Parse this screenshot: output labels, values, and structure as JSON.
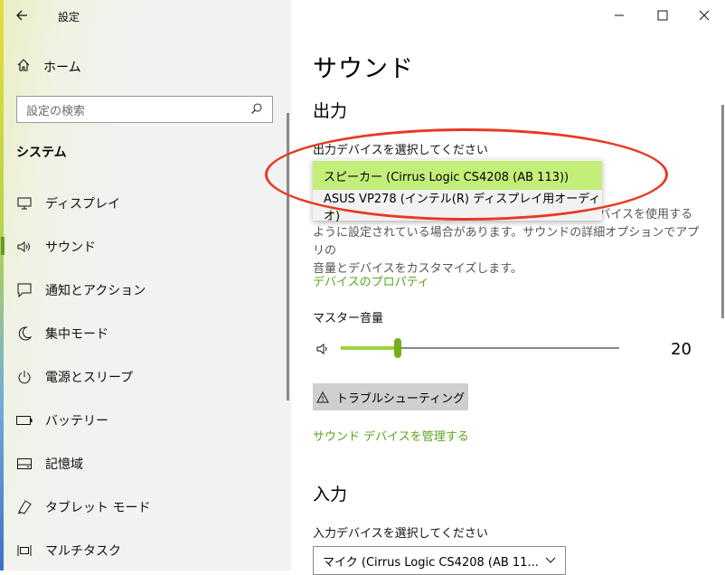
{
  "window": {
    "title": "設定",
    "controls": [
      "minimize",
      "maximize",
      "close"
    ]
  },
  "sidebar": {
    "home_label": "ホーム",
    "search_placeholder": "設定の検索",
    "section_title": "システム",
    "items": [
      {
        "label": "ディスプレイ",
        "icon": "display-icon"
      },
      {
        "label": "サウンド",
        "icon": "speaker-icon",
        "selected": true
      },
      {
        "label": "通知とアクション",
        "icon": "notification-icon"
      },
      {
        "label": "集中モード",
        "icon": "moon-icon"
      },
      {
        "label": "電源とスリープ",
        "icon": "power-icon"
      },
      {
        "label": "バッテリー",
        "icon": "battery-icon"
      },
      {
        "label": "記憶域",
        "icon": "storage-icon"
      },
      {
        "label": "タブレット モード",
        "icon": "tablet-icon"
      },
      {
        "label": "マルチタスク",
        "icon": "multitask-icon"
      }
    ]
  },
  "main": {
    "page_title": "サウンド",
    "output_heading": "出力",
    "output_device_label": "出力デバイスを選択してください",
    "output_options": [
      {
        "label": "スピーカー (Cirrus Logic CS4208 (AB 113))",
        "selected": true
      },
      {
        "label": "ASUS VP278 (インテル(R) ディスプレイ用オーディオ)",
        "selected": false
      }
    ],
    "description_line1": "デバイスを使用する",
    "description_line2": "ように設定されている場合があります。サウンドの詳細オプションでアプリの",
    "description_line3": "音量とデバイスをカスタマイズします。",
    "device_properties_link": "デバイスのプロパティ",
    "master_volume_label": "マスター音量",
    "master_volume_value": "20",
    "master_volume_level": 0.2,
    "troubleshoot_label": "トラブルシューティング",
    "manage_devices_link": "サウンド デバイスを管理する",
    "input_heading": "入力",
    "input_device_label": "入力デバイスを選択してください",
    "input_device_value": "マイク (Cirrus Logic CS4208 (AB 11..."
  },
  "colors": {
    "accent": "#73ae1f",
    "link": "#5aa51e",
    "selected_option": "#c4ee7a",
    "annotation": "#e63a22"
  }
}
